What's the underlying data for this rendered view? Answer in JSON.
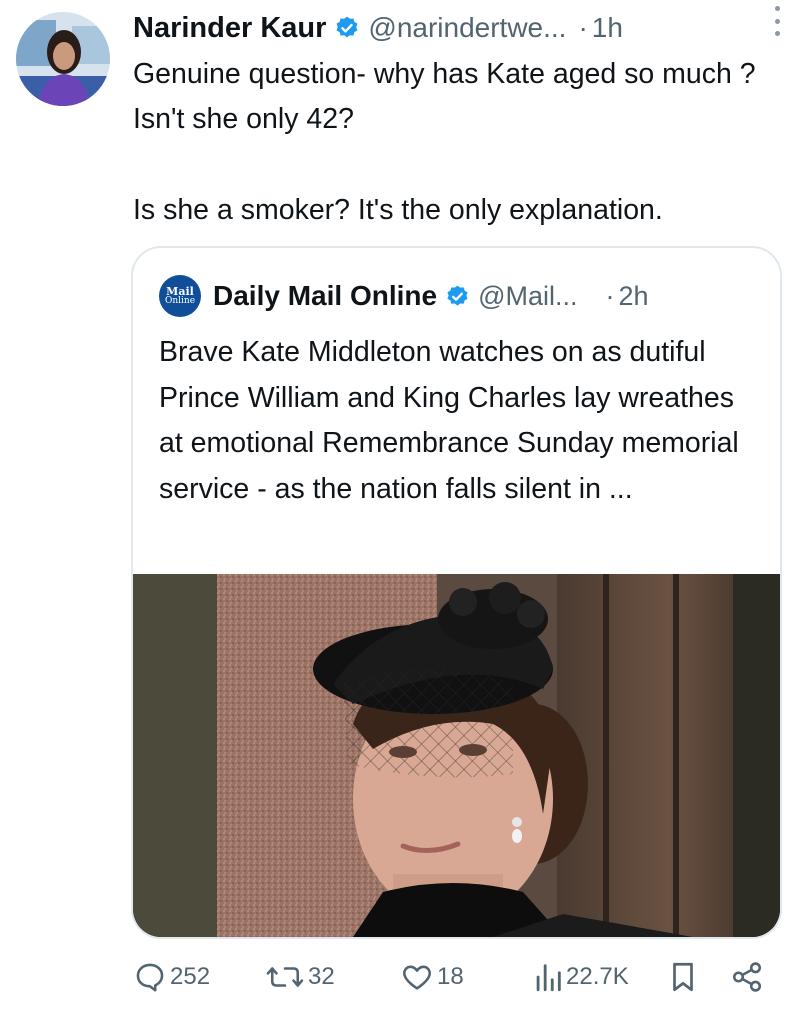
{
  "author": {
    "name": "Narinder Kaur",
    "handle": "@narindertwe...",
    "time": "1h",
    "verified": true
  },
  "tweet": {
    "paragraphs": [
      "Genuine question- why has Kate aged so much ? Isn't she only 42?",
      "Is she a smoker? It's the only explanation."
    ]
  },
  "quote": {
    "name": "Daily Mail Online",
    "handle": "@Mail...",
    "time": "2h",
    "logo_text": [
      "Mail",
      "Online"
    ],
    "text": "Brave Kate Middleton watches on as dutiful Prince William and King Charles lay wreathes at emotional Remembrance Sunday memorial service - as the nation falls silent in ..."
  },
  "actions": {
    "replies": "252",
    "reposts": "32",
    "likes": "18",
    "views": "22.7K"
  },
  "icons": {
    "verified": "verified-badge-icon",
    "more": "more-options-icon",
    "reply": "reply-icon",
    "repost": "repost-icon",
    "like": "heart-icon",
    "views": "views-icon",
    "bookmark": "bookmark-icon",
    "share": "share-icon"
  },
  "colors": {
    "verified_blue": "#1d9bf0",
    "muted_text": "#536471",
    "mail_logo_bg": "#104e9a"
  }
}
